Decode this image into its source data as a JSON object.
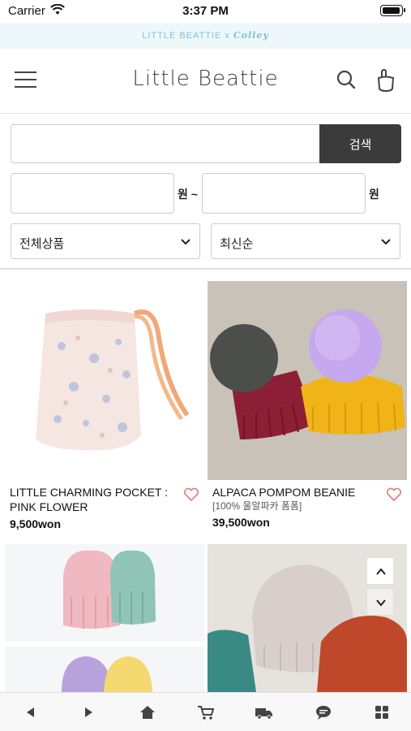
{
  "status_bar": {
    "carrier": "Carrier",
    "time": "3:37 PM"
  },
  "promo": {
    "brand": "LITTLE BEATTIE",
    "x": "x",
    "collab": "Colley"
  },
  "header": {
    "logo": "Little Beattie"
  },
  "search": {
    "button_label": "검색",
    "value": ""
  },
  "price_filter": {
    "min_value": "",
    "max_value": "",
    "min_unit": "원 ~",
    "max_unit": "원"
  },
  "filters": {
    "category": "전체상품",
    "sort": "최신순"
  },
  "products": [
    {
      "name": "LITTLE CHARMING POCKET : PINK FLOWER",
      "sub": "",
      "price": "9,500won"
    },
    {
      "name": "ALPACA POMPOM BEANIE",
      "sub": "[100% 울알파카 폼폼]",
      "price": "39,500won"
    }
  ],
  "bottom_nav": [
    "back-icon",
    "forward-icon",
    "home-icon",
    "cart-icon",
    "delivery-truck-icon",
    "chat-icon",
    "grid-menu-icon"
  ]
}
